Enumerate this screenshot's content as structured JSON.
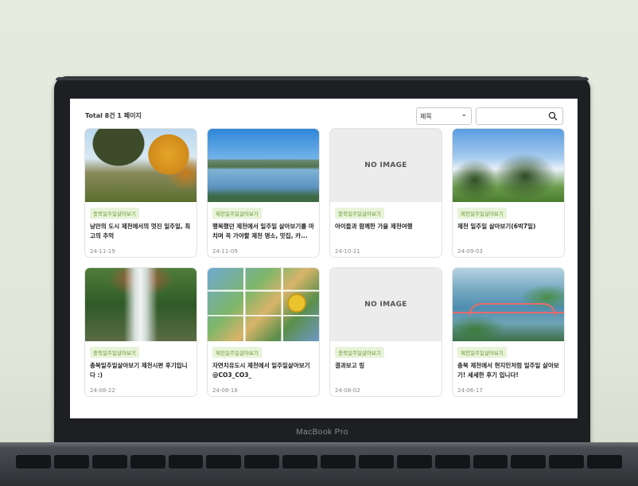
{
  "header": {
    "total_label": "Total 8건 1 페이지"
  },
  "search": {
    "filter_value": "제목",
    "filter_chevron": "⌄",
    "input_value": "",
    "placeholder": ""
  },
  "no_image_label": "NO IMAGE",
  "cards": [
    {
      "category": "충북일주일살아보기",
      "title": "낭만의 도시 제천에서의 멋진 일주일, 최고의 추억",
      "date": "24-11-19"
    },
    {
      "category": "제천일주일살아보기",
      "title": "행복했던 제천에서 일주일 살아보기를 마치며 꼭 가야할 제천 명소, 맛집, 카...",
      "date": "24-11-09"
    },
    {
      "category": "충북일주일살아보기",
      "title": "아이들과 함께한 가을 제천여행",
      "date": "24-10-21"
    },
    {
      "category": "제천일주일살아보기",
      "title": "제천 일주일 살아보기(6박7일)",
      "date": "24-09-03"
    },
    {
      "category": "충북일주일살아보기",
      "title": "충북일주일살아보기 제천시편 후기입니다 :)",
      "date": "24-08-22"
    },
    {
      "category": "제천일주일살아보기",
      "title": "자연치유도시 제천에서 일주일살아보기 @CO3_CO3_",
      "date": "24-08-18"
    },
    {
      "category": "충북일주일살아보기",
      "title": "결과보고 링",
      "date": "24-08-02"
    },
    {
      "category": "제천일주일살아보기",
      "title": "충북 제천에서 현지인처럼 일주일 살아보기! 세세한 후기 입니다!",
      "date": "24-06-17"
    }
  ],
  "device": {
    "brand": "MacBook Pro"
  },
  "colors": {
    "tag_bg": "#e8f3d9",
    "tag_text": "#6a9a34"
  }
}
